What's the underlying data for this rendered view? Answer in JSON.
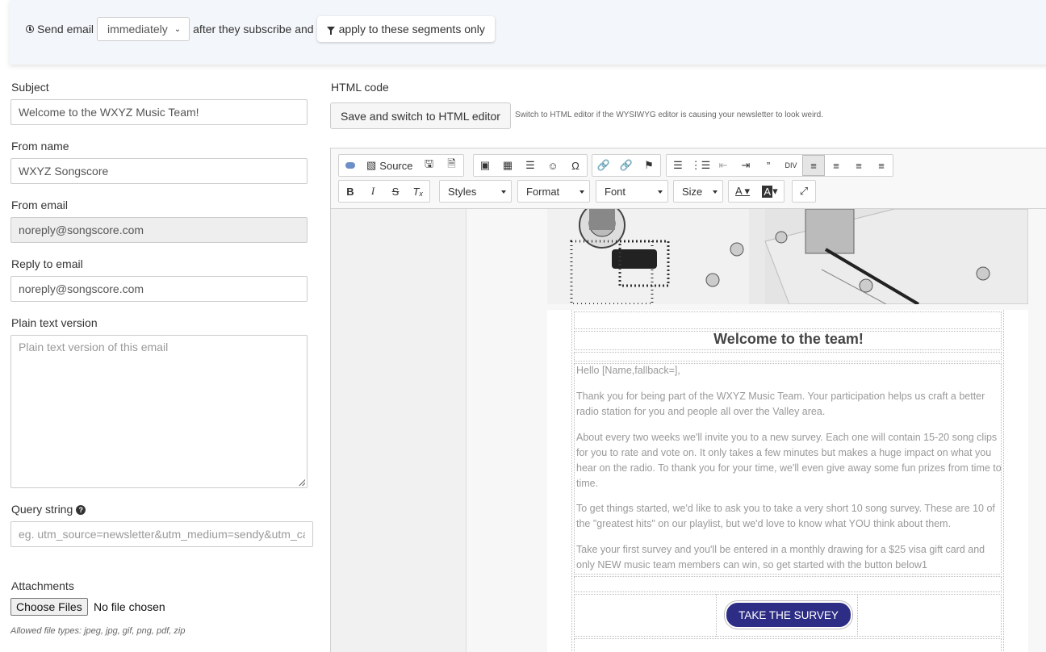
{
  "topbar": {
    "send_email": "Send email",
    "timing_value": "immediately",
    "after_text": "after they subscribe and",
    "segments_button": "apply to these segments only"
  },
  "form": {
    "subject_label": "Subject",
    "subject_value": "Welcome to the WXYZ Music Team!",
    "from_name_label": "From name",
    "from_name_value": "WXYZ Songscore",
    "from_email_label": "From email",
    "from_email_value": "noreply@songscore.com",
    "reply_to_label": "Reply to email",
    "reply_to_value": "noreply@songscore.com",
    "plain_text_label": "Plain text version",
    "plain_text_placeholder": "Plain text version of this email",
    "query_string_label": "Query string",
    "query_string_placeholder": "eg. utm_source=newsletter&utm_medium=sendy&utm_ca",
    "attachments_label": "Attachments",
    "choose_files": "Choose Files",
    "no_file": "No file chosen",
    "allowed_types": "Allowed file types: jpeg, jpg, gif, png, pdf, zip"
  },
  "editor": {
    "html_code_label": "HTML code",
    "switch_button": "Save and switch to HTML editor",
    "switch_note": "Switch to HTML editor if the WYSIWYG editor is causing your newsletter to look weird.",
    "source_label": "Source",
    "styles_label": "Styles",
    "format_label": "Format",
    "font_label": "Font",
    "size_label": "Size"
  },
  "email": {
    "heading": "Welcome to the team!",
    "greeting": "Hello [Name,fallback=],",
    "p1": "Thank you for being part of the WXYZ Music Team. Your participation helps us craft a better radio station for you and people all over the Valley area.",
    "p2": "About every two weeks we'll invite you to a new survey. Each one will contain 15-20 song clips for you to rate and vote on. It only takes a few minutes but makes a huge impact on what you hear on the radio. To thank you for your time, we'll even give away some fun prizes from time to time.",
    "p3": "To get things started, we'd like to ask you to take a very short 10 song survey. These are 10 of the \"greatest hits\" on our playlist, but we'd love to know what YOU think about them.",
    "p4": "Take your first survey and you'll be entered in a monthly drawing for a $25 visa gift card and only NEW music team members can win, so get started with the button below1",
    "cta": "TAKE THE SURVEY",
    "cta_color": "#2d2d86"
  }
}
